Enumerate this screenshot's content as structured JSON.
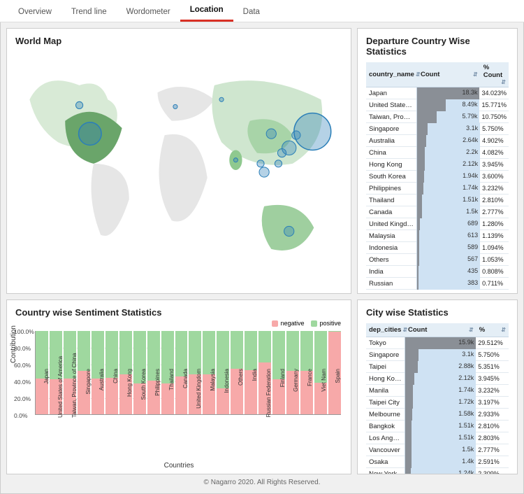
{
  "tabs": [
    "Overview",
    "Trend line",
    "Wordometer",
    "Location",
    "Data"
  ],
  "active_tab": "Location",
  "panels": {
    "map_title": "World Map",
    "departure_title": "Departure Country Wise Statistics",
    "sentiment_title": "Country wise Sentiment Statistics",
    "city_title": "City wise Statistics"
  },
  "departure": {
    "columns": {
      "name": "country_name",
      "count": "Count",
      "pct": "% Count"
    },
    "rows": [
      {
        "name": "Japan",
        "count": "18.3k",
        "pct": "34.023%",
        "bar": 100
      },
      {
        "name": "United States of America",
        "count": "8.49k",
        "pct": "15.771%",
        "bar": 46
      },
      {
        "name": "Taiwan, Province of China",
        "count": "5.79k",
        "pct": "10.750%",
        "bar": 32
      },
      {
        "name": "Singapore",
        "count": "3.1k",
        "pct": "5.750%",
        "bar": 17
      },
      {
        "name": "Australia",
        "count": "2.64k",
        "pct": "4.902%",
        "bar": 14
      },
      {
        "name": "China",
        "count": "2.2k",
        "pct": "4.082%",
        "bar": 12
      },
      {
        "name": "Hong Kong",
        "count": "2.12k",
        "pct": "3.945%",
        "bar": 12
      },
      {
        "name": "South Korea",
        "count": "1.94k",
        "pct": "3.600%",
        "bar": 11
      },
      {
        "name": "Philippines",
        "count": "1.74k",
        "pct": "3.232%",
        "bar": 10
      },
      {
        "name": "Thailand",
        "count": "1.51k",
        "pct": "2.810%",
        "bar": 8
      },
      {
        "name": "Canada",
        "count": "1.5k",
        "pct": "2.777%",
        "bar": 8
      },
      {
        "name": "United Kingdom",
        "count": "689",
        "pct": "1.280%",
        "bar": 4
      },
      {
        "name": "Malaysia",
        "count": "613",
        "pct": "1.139%",
        "bar": 3
      },
      {
        "name": "Indonesia",
        "count": "589",
        "pct": "1.094%",
        "bar": 3
      },
      {
        "name": "Others",
        "count": "567",
        "pct": "1.053%",
        "bar": 3
      },
      {
        "name": "India",
        "count": "435",
        "pct": "0.808%",
        "bar": 2
      },
      {
        "name": "Russian",
        "count": "383",
        "pct": "0.711%",
        "bar": 2
      }
    ]
  },
  "city": {
    "columns": {
      "name": "dep_cities",
      "count": "Count",
      "pct": "%"
    },
    "rows": [
      {
        "name": "Tokyo",
        "count": "15.9k",
        "pct": "29.512%",
        "bar": 100
      },
      {
        "name": "Singapore",
        "count": "3.1k",
        "pct": "5.750%",
        "bar": 19
      },
      {
        "name": "Taipei",
        "count": "2.88k",
        "pct": "5.351%",
        "bar": 18
      },
      {
        "name": "Hong Kong",
        "count": "2.12k",
        "pct": "3.945%",
        "bar": 13
      },
      {
        "name": "Manila",
        "count": "1.74k",
        "pct": "3.232%",
        "bar": 11
      },
      {
        "name": "Taipei City",
        "count": "1.72k",
        "pct": "3.197%",
        "bar": 11
      },
      {
        "name": "Melbourne",
        "count": "1.58k",
        "pct": "2.933%",
        "bar": 10
      },
      {
        "name": "Bangkok",
        "count": "1.51k",
        "pct": "2.810%",
        "bar": 9
      },
      {
        "name": "Los Angeles",
        "count": "1.51k",
        "pct": "2.803%",
        "bar": 9
      },
      {
        "name": "Vancouver",
        "count": "1.5k",
        "pct": "2.777%",
        "bar": 9
      },
      {
        "name": "Osaka",
        "count": "1.4k",
        "pct": "2.591%",
        "bar": 9
      },
      {
        "name": "New York",
        "count": "1.24k",
        "pct": "2.309%",
        "bar": 8
      }
    ]
  },
  "chart_data": {
    "type": "bar",
    "title": "Country wise Sentiment Statistics",
    "xlabel": "Countries",
    "ylabel": "Contribution",
    "ylim": [
      0,
      100
    ],
    "yticks": [
      "0.0%",
      "20.0%",
      "40.0%",
      "60.0%",
      "80.0%",
      "100.0%"
    ],
    "legend": {
      "negative": "negative",
      "positive": "positive"
    },
    "categories": [
      "Japan",
      "United States of America",
      "Taiwan, Province of China",
      "Singapore",
      "Australia",
      "China",
      "Hong Kong",
      "South Korea",
      "Philippines",
      "Thailand",
      "Canada",
      "United Kingdom",
      "Malaysia",
      "Indonesia",
      "Others",
      "India",
      "Russian Federation",
      "Finland",
      "Germany",
      "France",
      "Viet Nam",
      "Spain"
    ],
    "series": [
      {
        "name": "positive",
        "values": [
          57,
          58,
          57,
          48,
          57,
          56,
          52,
          63,
          60,
          63,
          55,
          52,
          52,
          69,
          45,
          47,
          38,
          58,
          48,
          48,
          62,
          1
        ]
      },
      {
        "name": "negative",
        "values": [
          43,
          42,
          43,
          52,
          43,
          44,
          48,
          37,
          40,
          37,
          45,
          48,
          48,
          31,
          55,
          53,
          62,
          42,
          52,
          52,
          38,
          99
        ]
      }
    ]
  },
  "footer": "© Nagarro 2020. All Rights Reserved."
}
